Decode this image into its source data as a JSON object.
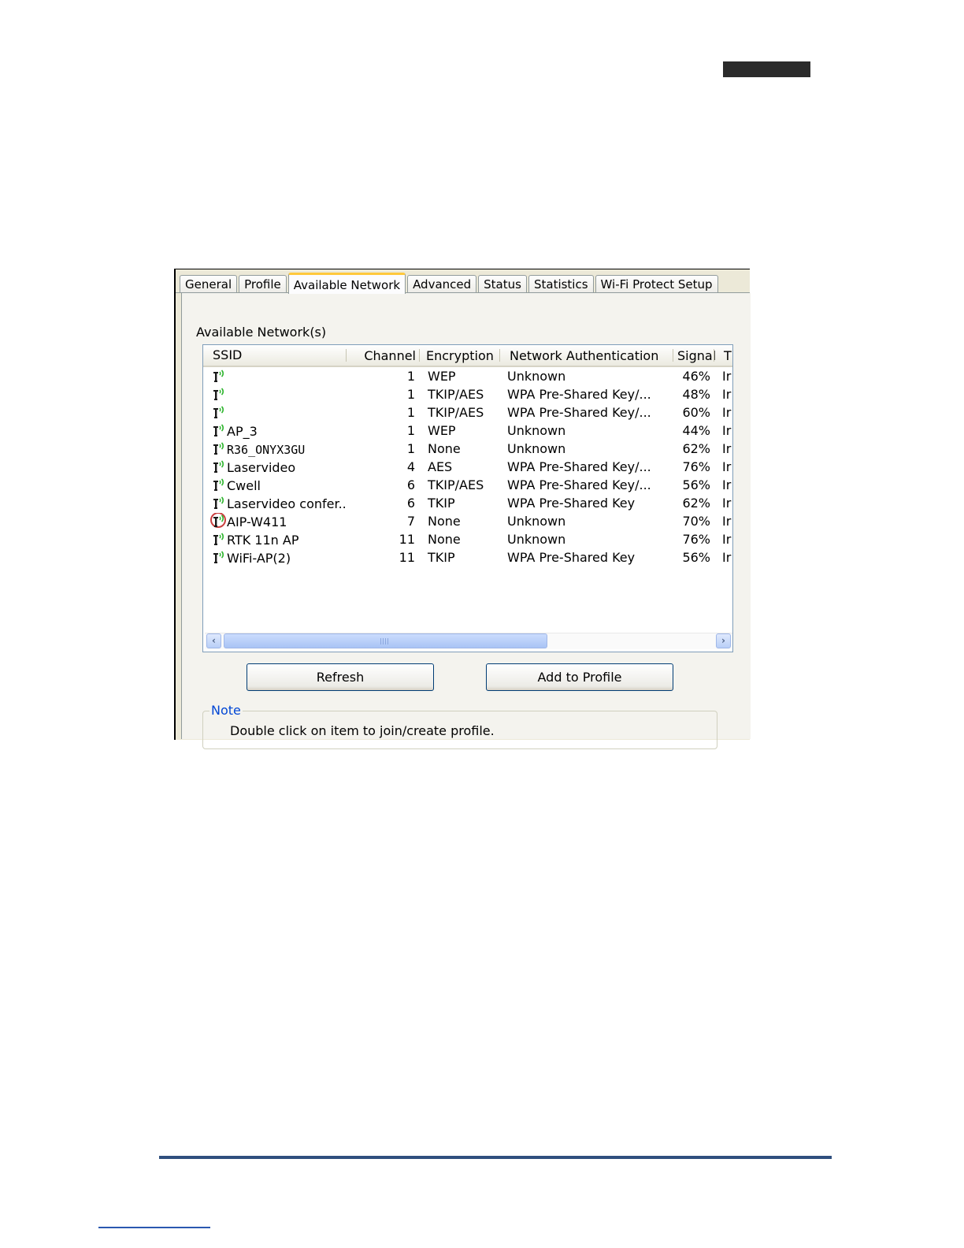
{
  "tabs": [
    "General",
    "Profile",
    "Available Network",
    "Advanced",
    "Status",
    "Statistics",
    "Wi-Fi Protect Setup"
  ],
  "active_tab": "Available Network",
  "group_title": "Available Network(s)",
  "columns": {
    "ssid": "SSID",
    "channel": "Channel",
    "encryption": "Encryption",
    "auth": "Network Authentication",
    "signal": "Signal",
    "type": "T"
  },
  "networks": [
    {
      "ssid": "",
      "channel": "1",
      "encryption": "WEP",
      "auth": "Unknown",
      "signal": "46%",
      "type": "Ir"
    },
    {
      "ssid": "",
      "channel": "1",
      "encryption": "TKIP/AES",
      "auth": "WPA Pre-Shared Key/...",
      "signal": "48%",
      "type": "Ir"
    },
    {
      "ssid": "",
      "channel": "1",
      "encryption": "TKIP/AES",
      "auth": "WPA Pre-Shared Key/...",
      "signal": "60%",
      "type": "Ir"
    },
    {
      "ssid": "AP_3",
      "channel": "1",
      "encryption": "WEP",
      "auth": "Unknown",
      "signal": "44%",
      "type": "Ir"
    },
    {
      "ssid": "R36_ONYX3GU",
      "channel": "1",
      "encryption": "None",
      "auth": "Unknown",
      "signal": "62%",
      "type": "Ir"
    },
    {
      "ssid": "Laservideo",
      "channel": "4",
      "encryption": "AES",
      "auth": "WPA Pre-Shared Key/...",
      "signal": "76%",
      "type": "Ir"
    },
    {
      "ssid": "Cwell",
      "channel": "6",
      "encryption": "TKIP/AES",
      "auth": "WPA Pre-Shared Key/...",
      "signal": "56%",
      "type": "Ir"
    },
    {
      "ssid": "Laservideo confer...",
      "channel": "6",
      "encryption": "TKIP",
      "auth": "WPA Pre-Shared Key",
      "signal": "62%",
      "type": "Ir"
    },
    {
      "ssid": "AIP-W411",
      "channel": "7",
      "encryption": "None",
      "auth": "Unknown",
      "signal": "70%",
      "type": "Ir"
    },
    {
      "ssid": "RTK 11n AP",
      "channel": "11",
      "encryption": "None",
      "auth": "Unknown",
      "signal": "76%",
      "type": "Ir"
    },
    {
      "ssid": "WiFi-AP(2)",
      "channel": "11",
      "encryption": "TKIP",
      "auth": "WPA Pre-Shared Key",
      "signal": "56%",
      "type": "Ir"
    }
  ],
  "highlighted_network": "AIP-W411",
  "buttons": {
    "refresh": "Refresh",
    "add_to_profile": "Add to Profile"
  },
  "note": {
    "legend": "Note",
    "text": "Double click on item to join/create profile."
  },
  "colors": {
    "accent_tab": "#ffc83c",
    "note_legend": "#0046d5",
    "signal_icon": "#2fb52f",
    "highlight_circle": "#c94040",
    "footer_rule": "#2f4f7e"
  }
}
